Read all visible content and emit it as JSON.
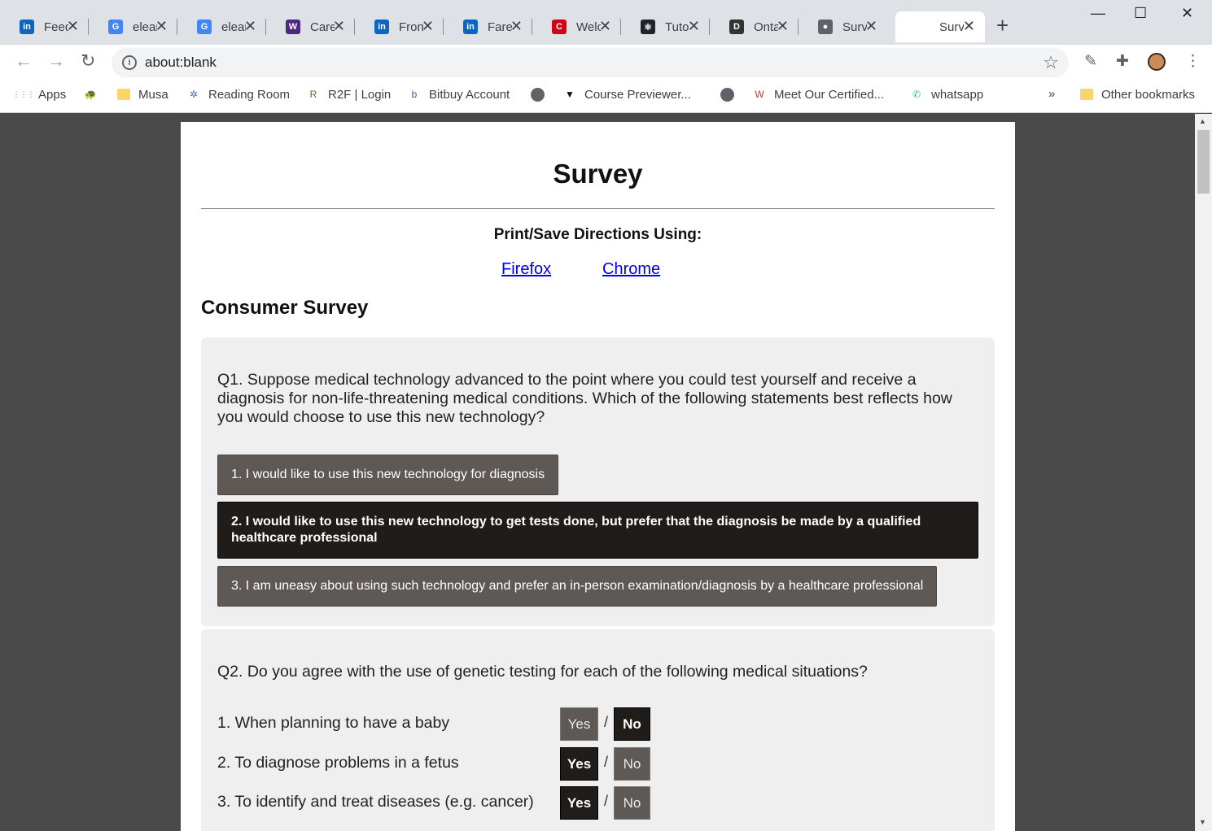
{
  "browser": {
    "tabs": [
      {
        "title": "Feed",
        "icon": "linkedin-icon",
        "color": "#0a66c2",
        "glyph": "in"
      },
      {
        "title": "eleanor",
        "icon": "google-icon",
        "color": "#4285f4",
        "glyph": "G"
      },
      {
        "title": "eleanor",
        "icon": "google-icon",
        "color": "#4285f4",
        "glyph": "G"
      },
      {
        "title": "Career",
        "icon": "western-icon",
        "color": "#4f2683",
        "glyph": "W"
      },
      {
        "title": "Front",
        "icon": "linkedin-icon",
        "color": "#0a66c2",
        "glyph": "in"
      },
      {
        "title": "Fare",
        "icon": "linkedin-icon",
        "color": "#0a66c2",
        "glyph": "in"
      },
      {
        "title": "Welcome",
        "icon": "c-icon",
        "color": "#d0021b",
        "glyph": "C"
      },
      {
        "title": "Tutorial",
        "icon": "react-icon",
        "color": "#20232a",
        "glyph": "⚛"
      },
      {
        "title": "Ontario",
        "icon": "dms-icon",
        "color": "#333333",
        "glyph": "D"
      },
      {
        "title": "Survey",
        "icon": "globe-icon",
        "color": "#5f6368",
        "glyph": "●"
      },
      {
        "title": "Survey",
        "icon": "blank-icon",
        "color": "#ffffff",
        "glyph": ""
      }
    ],
    "new_tab_glyph": "+",
    "window_controls": [
      "—",
      "☐",
      "✕"
    ],
    "address": "about:blank",
    "bookmarks": [
      {
        "label": "Apps",
        "icon": "apps-icon"
      },
      {
        "label": "",
        "icon": "turtle-icon"
      },
      {
        "label": "Musa",
        "icon": "folder-icon"
      },
      {
        "label": "Reading Room",
        "icon": "reading-room-icon"
      },
      {
        "label": "R2F | Login",
        "icon": "r2f-icon"
      },
      {
        "label": "Bitbuy Account",
        "icon": "bitbuy-icon"
      },
      {
        "label": "",
        "icon": "globe-icon"
      },
      {
        "label": "Course Previewer...",
        "icon": "course-icon"
      },
      {
        "label": "",
        "icon": "globe-icon"
      },
      {
        "label": "Meet Our Certified...",
        "icon": "certified-icon"
      },
      {
        "label": "whatsapp",
        "icon": "whatsapp-icon"
      }
    ],
    "more_bookmarks": "»",
    "other_bookmarks": "Other bookmarks"
  },
  "page": {
    "title": "Survey",
    "directions": "Print/Save Directions Using:",
    "links": [
      "Firefox",
      "Chrome"
    ],
    "survey_heading": "Consumer Survey",
    "q1": {
      "text": "Q1. Suppose medical technology advanced to the point where you could test yourself and receive a diagnosis for non-life-threatening medical conditions. Which of the following statements best reflects how you would choose to use this new technology?",
      "options": [
        "1. I would like to use this new technology for diagnosis",
        "2. I would like to use this new technology to get tests done, but prefer that the diagnosis be made by a qualified healthcare professional",
        "3. I am uneasy about using such technology and prefer an in-person examination/diagnosis by a healthcare professional"
      ],
      "selected_option": 2
    },
    "q2": {
      "text": "Q2. Do you agree with the use of genetic testing for each of the following medical situations?",
      "yes_label": "Yes",
      "no_label": "No",
      "separator": "/",
      "rows": [
        {
          "label": "1. When planning to have a baby",
          "answer": "No"
        },
        {
          "label": "2. To diagnose problems in a fetus",
          "answer": "Yes"
        },
        {
          "label": "3. To identify and treat diseases (e.g. cancer)",
          "answer": "Yes"
        }
      ]
    }
  }
}
